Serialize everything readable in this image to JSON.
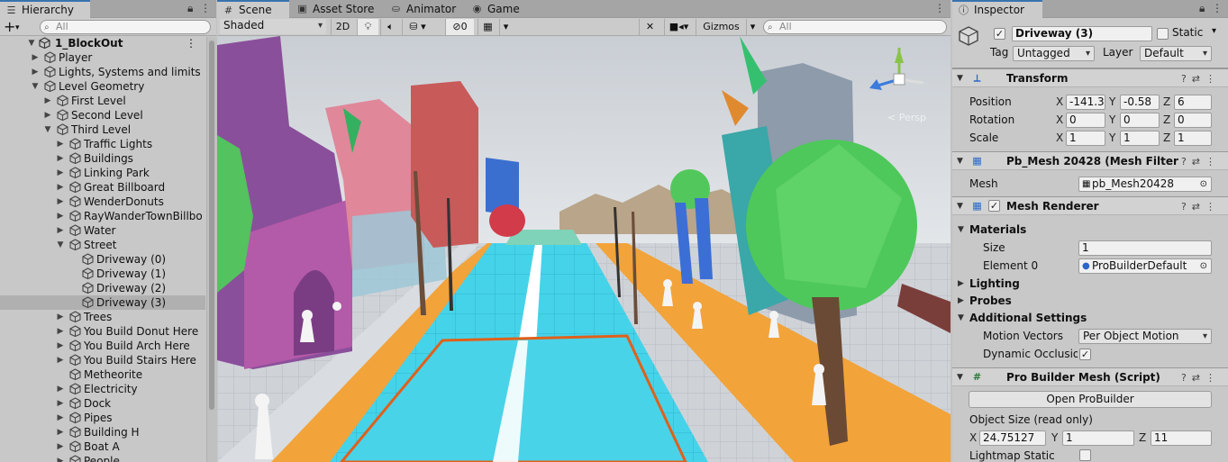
{
  "hierarchy": {
    "tab_label": "Hierarchy",
    "add_label": "+",
    "search_placeholder": "All",
    "scene_name": "1_BlockOut",
    "items": [
      {
        "label": "Player",
        "depth": 1,
        "arrow": "right",
        "selected": false
      },
      {
        "label": "Lights, Systems and limits",
        "depth": 1,
        "arrow": "right",
        "selected": false
      },
      {
        "label": "Level Geometry",
        "depth": 1,
        "arrow": "down",
        "selected": false
      },
      {
        "label": "First Level",
        "depth": 2,
        "arrow": "right",
        "selected": false
      },
      {
        "label": "Second Level",
        "depth": 2,
        "arrow": "right",
        "selected": false
      },
      {
        "label": "Third Level",
        "depth": 2,
        "arrow": "down",
        "selected": false
      },
      {
        "label": "Traffic Lights",
        "depth": 3,
        "arrow": "right",
        "selected": false
      },
      {
        "label": "Buildings",
        "depth": 3,
        "arrow": "right",
        "selected": false
      },
      {
        "label": "Linking Park",
        "depth": 3,
        "arrow": "right",
        "selected": false
      },
      {
        "label": "Great Billboard",
        "depth": 3,
        "arrow": "right",
        "selected": false
      },
      {
        "label": "WenderDonuts",
        "depth": 3,
        "arrow": "right",
        "selected": false
      },
      {
        "label": "RayWanderTownBillbo",
        "depth": 3,
        "arrow": "right",
        "selected": false
      },
      {
        "label": "Water",
        "depth": 3,
        "arrow": "right",
        "selected": false
      },
      {
        "label": "Street",
        "depth": 3,
        "arrow": "down",
        "selected": false
      },
      {
        "label": "Driveway (0)",
        "depth": 4,
        "arrow": "",
        "selected": false
      },
      {
        "label": "Driveway (1)",
        "depth": 4,
        "arrow": "",
        "selected": false
      },
      {
        "label": "Driveway (2)",
        "depth": 4,
        "arrow": "",
        "selected": false
      },
      {
        "label": "Driveway (3)",
        "depth": 4,
        "arrow": "",
        "selected": true
      },
      {
        "label": "Trees",
        "depth": 3,
        "arrow": "right",
        "selected": false
      },
      {
        "label": "You Build Donut Here",
        "depth": 3,
        "arrow": "right",
        "selected": false
      },
      {
        "label": "You Build Arch Here",
        "depth": 3,
        "arrow": "right",
        "selected": false
      },
      {
        "label": "You Build Stairs Here",
        "depth": 3,
        "arrow": "right",
        "selected": false
      },
      {
        "label": "Metheorite",
        "depth": 3,
        "arrow": "",
        "selected": false
      },
      {
        "label": "Electricity",
        "depth": 3,
        "arrow": "right",
        "selected": false
      },
      {
        "label": "Dock",
        "depth": 3,
        "arrow": "right",
        "selected": false
      },
      {
        "label": "Pipes",
        "depth": 3,
        "arrow": "right",
        "selected": false
      },
      {
        "label": "Building H",
        "depth": 3,
        "arrow": "right",
        "selected": false
      },
      {
        "label": "Boat A",
        "depth": 3,
        "arrow": "right",
        "selected": false
      },
      {
        "label": "People",
        "depth": 3,
        "arrow": "right",
        "selected": false
      }
    ]
  },
  "scene_tabs": {
    "scene": "Scene",
    "asset_store": "Asset Store",
    "animator": "Animator",
    "game": "Game"
  },
  "scene_toolbar": {
    "shading_mode": "Shaded",
    "mode_2d": "2D",
    "hidden_count": "0",
    "gizmos": "Gizmos",
    "search_placeholder": "All"
  },
  "gizmo": {
    "persp_label": "< Persp"
  },
  "inspector": {
    "tab_label": "Inspector",
    "object_name": "Driveway (3)",
    "active_checked": true,
    "static_label": "Static",
    "static_checked": false,
    "tag_label": "Tag",
    "tag_value": "Untagged",
    "layer_label": "Layer",
    "layer_value": "Default",
    "transform": {
      "title": "Transform",
      "position_label": "Position",
      "rotation_label": "Rotation",
      "scale_label": "Scale",
      "position": {
        "x": "-141.3",
        "y": "-0.58",
        "z": "6"
      },
      "rotation": {
        "x": "0",
        "y": "0",
        "z": "0"
      },
      "scale": {
        "x": "1",
        "y": "1",
        "z": "1"
      }
    },
    "axis": {
      "x": "X",
      "y": "Y",
      "z": "Z"
    },
    "mesh_filter": {
      "title": "Pb_Mesh 20428 (Mesh Filter",
      "mesh_label": "Mesh",
      "mesh_value": "pb_Mesh20428"
    },
    "mesh_renderer": {
      "title": "Mesh Renderer",
      "enabled": true,
      "materials_label": "Materials",
      "size_label": "Size",
      "size_value": "1",
      "element0_label": "Element 0",
      "element0_value": "ProBuilderDefault",
      "lighting_label": "Lighting",
      "probes_label": "Probes",
      "additional_label": "Additional Settings",
      "motion_vectors_label": "Motion Vectors",
      "motion_vectors_value": "Per Object Motion",
      "dynamic_occlusion_label": "Dynamic Occlusio",
      "dynamic_occlusion_checked": true
    },
    "probuilder": {
      "title": "Pro Builder Mesh (Script)",
      "open_button": "Open ProBuilder",
      "object_size_label": "Object Size (read only)",
      "size": {
        "x": "24.75127",
        "y": "1",
        "z": "11"
      },
      "lightmap_static_label": "Lightmap Static",
      "lightmap_static_checked": false
    }
  },
  "colors": {
    "tab_accent": "#3a72b0",
    "road_cyan": "#3fd0e8",
    "sidewalk_orange": "#f2a33a",
    "selection_outline": "#e0601a",
    "sky": "#d8dde0",
    "tree_green": "#4ec85a"
  }
}
